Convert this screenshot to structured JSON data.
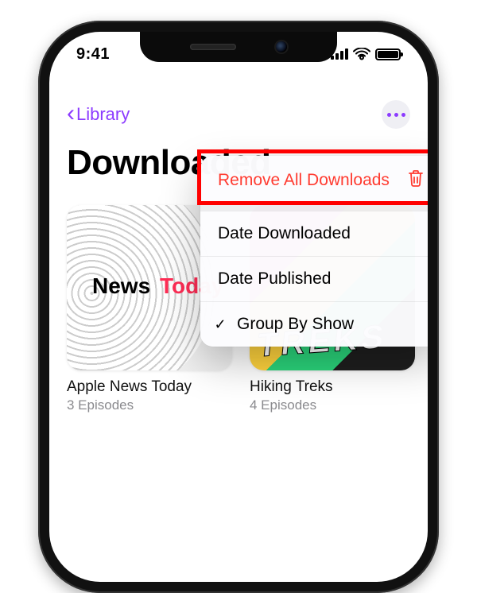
{
  "status": {
    "time": "9:41"
  },
  "nav": {
    "back_label": "Library"
  },
  "page": {
    "title": "Downloaded"
  },
  "menu": {
    "remove_all": "Remove All Downloads",
    "date_downloaded": "Date Downloaded",
    "date_published": "Date Published",
    "group_by_show": "Group By Show"
  },
  "shows": [
    {
      "title": "Apple News Today",
      "subtitle": "3 Episodes",
      "art_brand_a": "News",
      "art_brand_b": "Today"
    },
    {
      "title": "Hiking Treks",
      "subtitle": "4 Episodes",
      "art_text": "TREKS"
    }
  ]
}
